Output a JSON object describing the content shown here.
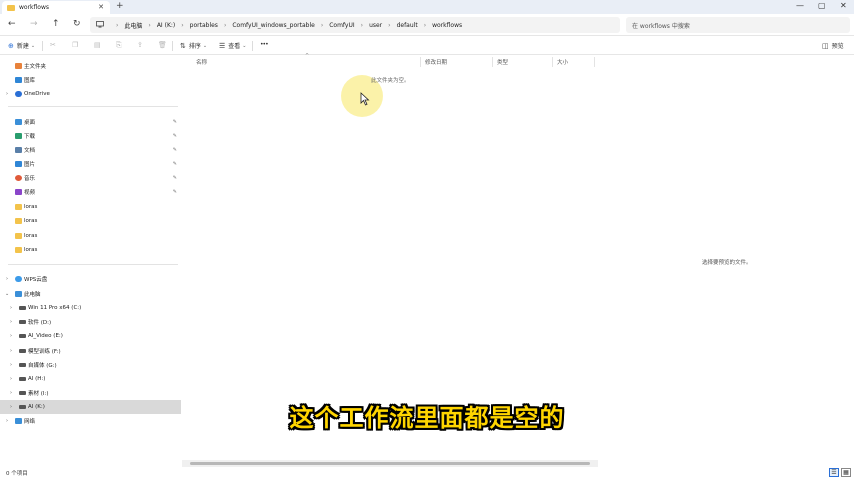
{
  "window": {
    "tab_title": "workflows",
    "tab_close": "✕",
    "new_tab": "+",
    "minimize": "—",
    "maximize": "▢",
    "close": "✕"
  },
  "nav": {
    "back": "←",
    "forward": "→",
    "up": "↑",
    "refresh": "↻",
    "this_pc_icon": "monitor-icon",
    "breadcrumbs": [
      "此电脑",
      "AI (K:)",
      "portables",
      "ComfyUI_windows_portable",
      "ComfyUI",
      "user",
      "default",
      "workflows"
    ],
    "search_placeholder": "在 workflows 中搜索"
  },
  "toolbar": {
    "new_label": "新建",
    "sort_label": "排序",
    "view_label": "查看",
    "more_label": "•••",
    "details_label": "预览",
    "accent": "#2a6fd6"
  },
  "sidebar": {
    "quick": [
      {
        "label": "主文件夹",
        "icon": "home-icon",
        "color": "#e8823b"
      },
      {
        "label": "图库",
        "icon": "gallery-icon",
        "color": "#2f86d6"
      },
      {
        "label": "OneDrive",
        "icon": "cloud-icon",
        "color": "#2a6fd6"
      }
    ],
    "pinned": [
      {
        "label": "桌面",
        "icon": "desktop-icon",
        "color": "#3a8fd8"
      },
      {
        "label": "下载",
        "icon": "download-icon",
        "color": "#2a9d6e"
      },
      {
        "label": "文档",
        "icon": "documents-icon",
        "color": "#5a7fa8"
      },
      {
        "label": "图片",
        "icon": "pictures-icon",
        "color": "#2f86d6"
      },
      {
        "label": "音乐",
        "icon": "music-icon",
        "color": "#e05a3a"
      },
      {
        "label": "视频",
        "icon": "videos-icon",
        "color": "#8a45c9"
      },
      {
        "label": "loras",
        "icon": "folder-icon",
        "color": "#f3c34b"
      },
      {
        "label": "loras",
        "icon": "folder-icon",
        "color": "#f3c34b"
      },
      {
        "label": "loras",
        "icon": "folder-icon",
        "color": "#f3c34b"
      },
      {
        "label": "loras",
        "icon": "folder-icon",
        "color": "#f3c34b"
      }
    ],
    "pin_glyph": "✎",
    "wps": "WPS云盘",
    "this_pc": "此电脑",
    "drives": [
      "Win 11 Pro x64 (C:)",
      "软件 (D:)",
      "AI_Video (E:)",
      "模型训练 (F:)",
      "自媒体 (G:)",
      "AI (H:)",
      "素材 (I:)",
      "AI (K:)"
    ],
    "network": "网络"
  },
  "filelist": {
    "columns": [
      "名称",
      "修改日期",
      "类型",
      "大小"
    ],
    "sort_indicator": "^",
    "empty_message": "此文件夹为空。"
  },
  "preview": {
    "message": "选择要预览的文件。"
  },
  "subtitle": "这个工作流里面都是空的",
  "status": {
    "item_count": "0 个项目",
    "details_view": "☰",
    "tiles_view": "▦"
  }
}
